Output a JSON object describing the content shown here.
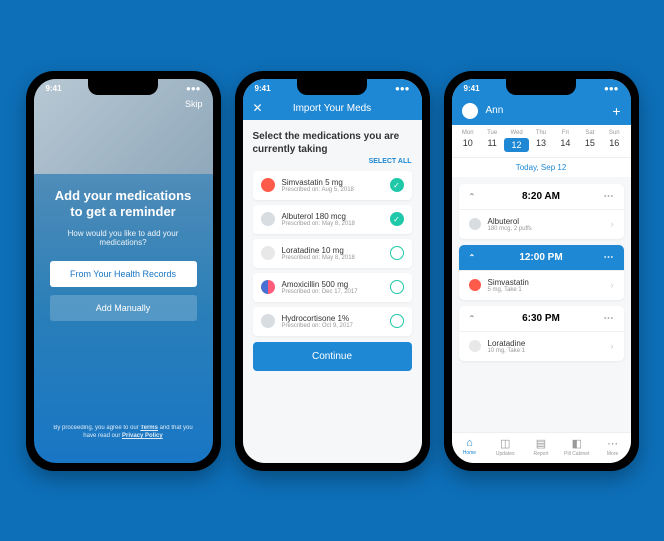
{
  "status_time": "9:41",
  "phone1": {
    "skip": "Skip",
    "title": "Add your medications to get a reminder",
    "subtitle": "How would you like to add your medications?",
    "btn_records": "From Your Health Records",
    "btn_manual": "Add Manually",
    "legal_pre": "By proceeding, you agree to our ",
    "legal_terms": "Terms",
    "legal_mid": " and that you have read our ",
    "legal_privacy": "Privacy Policy"
  },
  "phone2": {
    "header": "Import Your Meds",
    "heading": "Select the medications you are currently taking",
    "select_all": "SELECT ALL",
    "meds": [
      {
        "name": "Simvastatin 5 mg",
        "date": "Prescribed on: Aug 5, 2018",
        "color": "#ff5b4a",
        "checked": true
      },
      {
        "name": "Albuterol 180 mcg",
        "date": "Prescribed on: May 8, 2018",
        "color": "#d8dde2",
        "checked": true
      },
      {
        "name": "Loratadine 10 mg",
        "date": "Prescribed on: May 8, 2018",
        "color": "#e8e8e8",
        "checked": false
      },
      {
        "name": "Amoxicillin 500 mg",
        "date": "Prescribed on: Dec 17, 2017",
        "color": "linear-gradient(90deg,#4a6fd4 50%,#ff5b7a 50%)",
        "checked": false
      },
      {
        "name": "Hydrocortisone 1%",
        "date": "Prescribed on: Oct 9, 2017",
        "color": "#d8dde2",
        "checked": false
      }
    ],
    "continue": "Continue"
  },
  "phone3": {
    "user": "Ann",
    "days": [
      {
        "name": "Mon",
        "num": "10"
      },
      {
        "name": "Tue",
        "num": "11"
      },
      {
        "name": "Wed",
        "num": "12",
        "active": true
      },
      {
        "name": "Thu",
        "num": "13"
      },
      {
        "name": "Fri",
        "num": "14"
      },
      {
        "name": "Sat",
        "num": "15"
      },
      {
        "name": "Sun",
        "num": "16"
      }
    ],
    "today": "Today, Sep 12",
    "slots": [
      {
        "time": "8:20 AM",
        "highlight": false,
        "items": [
          {
            "name": "Albuterol",
            "dose": "180 mcg, 2 puffs",
            "color": "#d8dde2"
          }
        ]
      },
      {
        "time": "12:00 PM",
        "highlight": true,
        "items": [
          {
            "name": "Simvastatin",
            "dose": "5 mg, Take 1",
            "color": "#ff5b4a"
          }
        ]
      },
      {
        "time": "6:30 PM",
        "highlight": false,
        "items": [
          {
            "name": "Loratadine",
            "dose": "10 mg, Take 1",
            "color": "#e8e8e8"
          }
        ]
      }
    ],
    "tabs": [
      {
        "label": "Home",
        "icon": "⌂",
        "active": true
      },
      {
        "label": "Updates",
        "icon": "◫"
      },
      {
        "label": "Report",
        "icon": "▤"
      },
      {
        "label": "Pill Cabinet",
        "icon": "◧"
      },
      {
        "label": "More",
        "icon": "⋯"
      }
    ]
  }
}
